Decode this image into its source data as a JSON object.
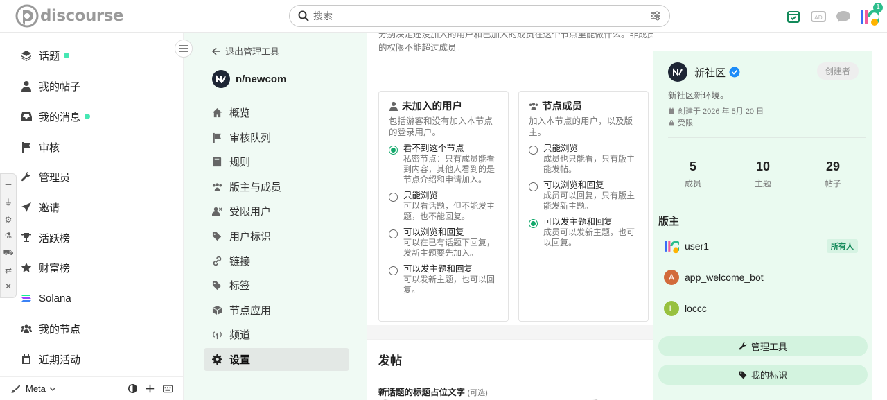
{
  "header": {
    "logo_text": "discourse",
    "search_placeholder": "搜索",
    "notification_count": "1"
  },
  "sidebar": {
    "items": [
      {
        "label": "话题",
        "dot": true
      },
      {
        "label": "我的帖子"
      },
      {
        "label": "我的消息",
        "dot": true
      },
      {
        "label": "审核"
      },
      {
        "label": "管理员"
      },
      {
        "label": "邀请"
      },
      {
        "label": "活跃榜"
      },
      {
        "label": "财富榜"
      },
      {
        "label": "Solana"
      },
      {
        "label": "我的节点"
      },
      {
        "label": "近期活动"
      }
    ],
    "bottom_label": "Meta"
  },
  "admin": {
    "back_label": "退出管理工具",
    "node_name": "n/newcom",
    "menu": [
      "概览",
      "审核队列",
      "规则",
      "版主与成员",
      "受限用户",
      "用户标识",
      "链接",
      "标签",
      "节点应用",
      "频道",
      "设置"
    ]
  },
  "main": {
    "top_desc": "分别决定还没加入的用户和已加入的成员在这个节点里能做什么。非成员的权限不能超过成员。",
    "nonmember": {
      "title": "未加入的用户",
      "desc": "包括游客和没有加入本节点的登录用户。",
      "options": [
        {
          "label": "看不到这个节点",
          "desc": "私密节点：只有成员能看到内容，其他人看到的是节点介绍和申请加入。",
          "checked": true
        },
        {
          "label": "只能浏览",
          "desc": "可以看话题，但不能发主题，也不能回复。"
        },
        {
          "label": "可以浏览和回复",
          "desc": "可以在已有话题下回复，发新主题要先加入。"
        },
        {
          "label": "可以发主题和回复",
          "desc": "可以发新主题，也可以回复。"
        }
      ]
    },
    "member": {
      "title": "节点成员",
      "desc": "加入本节点的用户，以及版主。",
      "options": [
        {
          "label": "只能浏览",
          "desc": "成员也只能看，只有版主能发帖。"
        },
        {
          "label": "可以浏览和回复",
          "desc": "成员可以回复，只有版主能发新主题。"
        },
        {
          "label": "可以发主题和回复",
          "desc": "成员可以发新主题，也可以回复。",
          "checked": true
        }
      ]
    },
    "post": {
      "title": "发帖",
      "field_label": "新话题的标题占位文字",
      "field_optional": "(可选)"
    }
  },
  "right": {
    "name": "新社区",
    "creator": "创建者",
    "desc": "新社区新环境。",
    "created": "创建于 2026 年 5月 20 日",
    "access": "受限",
    "stats": [
      {
        "num": "5",
        "label": "成员"
      },
      {
        "num": "10",
        "label": "主题"
      },
      {
        "num": "29",
        "label": "帖子"
      }
    ],
    "mods_title": "版主",
    "mods": [
      {
        "name": "user1",
        "badge": "所有人",
        "initial": "",
        "color": "#ffffff"
      },
      {
        "name": "app_welcome_bot",
        "initial": "A",
        "color": "#d26a3b"
      },
      {
        "name": "loccc",
        "initial": "L",
        "color": "#97c13f"
      }
    ],
    "btn_admin": "管理工具",
    "btn_tags": "我的标识"
  }
}
